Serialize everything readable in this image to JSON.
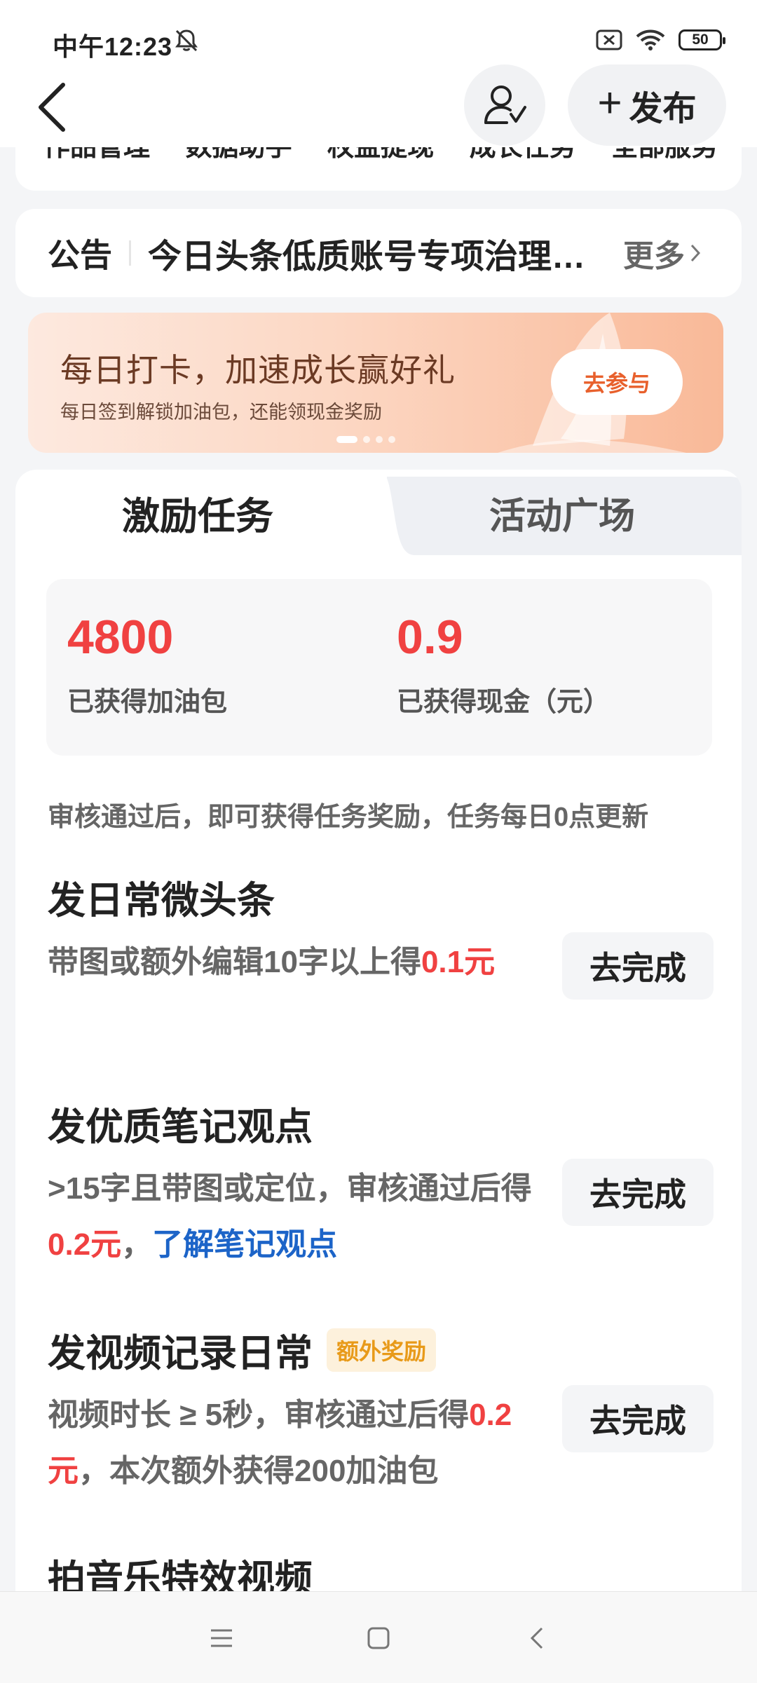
{
  "status_bar": {
    "time": "中午12:23",
    "battery": "50",
    "icons": [
      "bell-off-icon",
      "sim-disabled-icon",
      "wifi-icon",
      "battery-icon"
    ]
  },
  "header": {
    "back_icon": "chevron-left-icon",
    "user_icon": "user-check-icon",
    "publish_label": "发布"
  },
  "top_card": {
    "partial_text": "作品管理  数据助手  权益提现  成长任务  全部服务"
  },
  "notice": {
    "label": "公告",
    "text": "今日头条低质账号专项治理…",
    "more": "更多"
  },
  "banner": {
    "title": "每日打卡，加速成长赢好礼",
    "subtitle": "每日签到解锁加油包，还能领现金奖励",
    "button": "去参与"
  },
  "tabs": [
    {
      "label": "激励任务",
      "active": true
    },
    {
      "label": "活动广场",
      "active": false
    }
  ],
  "stats": [
    {
      "value": "4800",
      "label": "已获得加油包"
    },
    {
      "value": "0.9",
      "label": "已获得现金（元）"
    }
  ],
  "hint": "审核通过后，即可获得任务奖励，任务每日0点更新",
  "tasks": [
    {
      "title": "发日常微头条",
      "badge": "",
      "desc_parts": [
        "带图或额外编辑10字以上得",
        "0.1元",
        "",
        ""
      ],
      "button": "去完成"
    },
    {
      "title": "发优质笔记观点",
      "badge": "",
      "desc_parts": [
        ">15字且带图或定位，审核通过后得",
        "0.2元",
        "，",
        "了解笔记观点"
      ],
      "button": "去完成"
    },
    {
      "title": "发视频记录日常",
      "badge": "额外奖励",
      "desc_parts": [
        "视频时长 ≥ 5秒，审核通过后得",
        "0.2元",
        "，本次额外获得200加油包",
        ""
      ],
      "button": "去完成"
    },
    {
      "title": "拍音乐特效视频",
      "badge": "",
      "desc_parts": [
        "",
        "",
        "",
        ""
      ],
      "button": ""
    }
  ],
  "colors": {
    "accent_red": "#f04141",
    "link_blue": "#1c64c8",
    "badge_orange": "#e89a19",
    "banner_button_text": "#e8602c"
  },
  "navbar": {
    "items": [
      "menu-icon",
      "home-square-icon",
      "back-triangle-icon"
    ]
  }
}
